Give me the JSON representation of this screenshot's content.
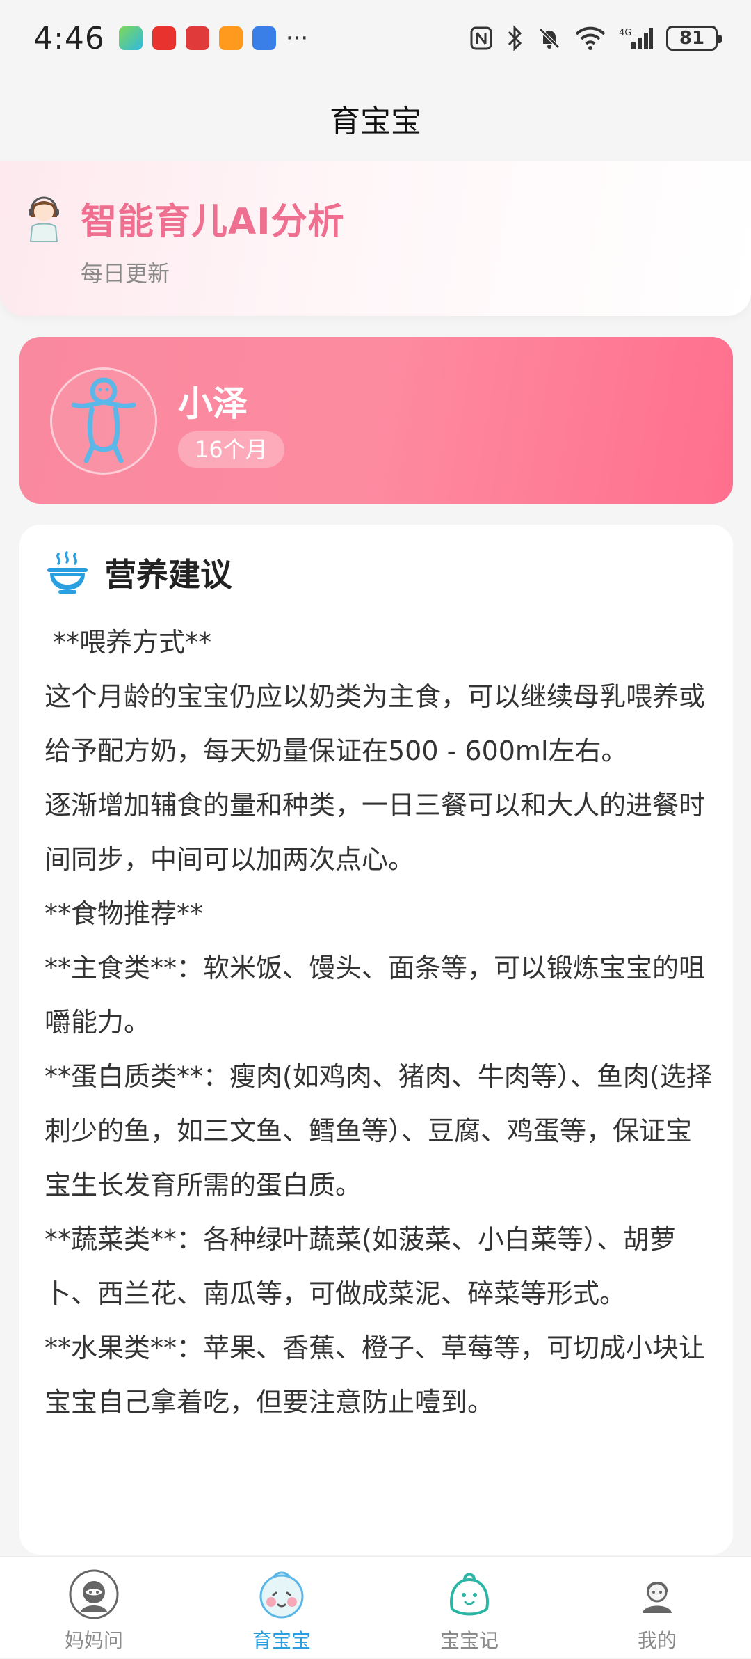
{
  "status_bar": {
    "time": "4:46",
    "more": "···",
    "battery": "81"
  },
  "header": {
    "title": "育宝宝"
  },
  "ai_banner": {
    "title": "智能育儿AI分析",
    "subtitle": "每日更新"
  },
  "baby": {
    "name": "小泽",
    "age": "16个月"
  },
  "nutrition": {
    "title": "营养建议",
    "lines": [
      " **喂养方式**",
      "这个月龄的宝宝仍应以奶类为主食，可以继续母乳喂养或给予配方奶，每天奶量保证在500 - 600ml左右。",
      "逐渐增加辅食的量和种类，一日三餐可以和大人的进餐时间同步，中间可以加两次点心。",
      "**食物推荐**",
      "**主食类**：软米饭、馒头、面条等，可以锻炼宝宝的咀嚼能力。",
      "**蛋白质类**：瘦肉(如鸡肉、猪肉、牛肉等）、鱼肉(选择刺少的鱼，如三文鱼、鳕鱼等）、豆腐、鸡蛋等，保证宝宝生长发育所需的蛋白质。",
      "**蔬菜类**：各种绿叶蔬菜(如菠菜、小白菜等）、胡萝卜、西兰花、南瓜等，可做成菜泥、碎菜等形式。",
      "**水果类**：苹果、香蕉、橙子、草莓等，可切成小块让宝宝自己拿着吃，但要注意防止噎到。"
    ]
  },
  "nav": {
    "items": [
      {
        "label": "妈妈问",
        "icon": "mom-ask-icon",
        "active": false
      },
      {
        "label": "育宝宝",
        "icon": "baby-face-icon",
        "active": true
      },
      {
        "label": "宝宝记",
        "icon": "baby-record-icon",
        "active": false
      },
      {
        "label": "我的",
        "icon": "profile-icon",
        "active": false
      }
    ]
  },
  "colors": {
    "accent_pink": "#ee6f8f",
    "card_pink": "#fd8ba0",
    "nav_active": "#2a9fe0"
  }
}
